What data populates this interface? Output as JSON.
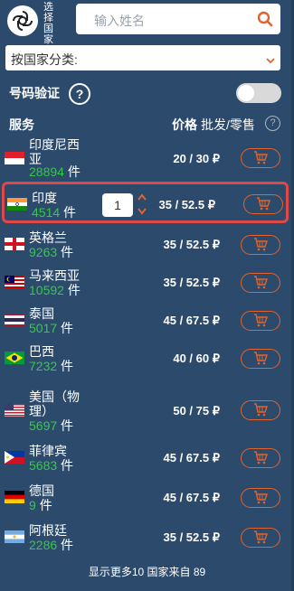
{
  "brand": {
    "text": "选择国家"
  },
  "search": {
    "placeholder": "输入姓名"
  },
  "category_select": {
    "value": "按国家分类:"
  },
  "verify": {
    "label": "号码验证",
    "help": "?",
    "enabled": false
  },
  "table_header": {
    "service": "服务",
    "price": "价格",
    "sub": "批发/零售",
    "help": "?"
  },
  "currency": "₽",
  "rows": [
    {
      "name": "印度尼西亚",
      "count": "28894",
      "unit": "件",
      "price": "20 / 30 ₽",
      "flag": "indonesia"
    },
    {
      "name": "印度",
      "count": "4514",
      "unit": "件",
      "price": "35 / 52.5 ₽",
      "flag": "india",
      "qty": "1",
      "selected": true
    },
    {
      "name": "英格兰",
      "count": "9263",
      "unit": "件",
      "price": "35 / 52.5 ₽",
      "flag": "england"
    },
    {
      "name": "马来西亚",
      "count": "10592",
      "unit": "件",
      "price": "35 / 52.5 ₽",
      "flag": "malaysia"
    },
    {
      "name": "泰国",
      "count": "5017",
      "unit": "件",
      "price": "45 / 67.5 ₽",
      "flag": "thailand"
    },
    {
      "name": "巴西",
      "count": "7232",
      "unit": "件",
      "price": "40 / 60 ₽",
      "flag": "brazil"
    },
    {
      "name": "美国（物理）",
      "count": "5697",
      "unit": "件",
      "price": "50 / 75 ₽",
      "flag": "usa"
    },
    {
      "name": "菲律宾",
      "count": "5683",
      "unit": "件",
      "price": "45 / 67.5 ₽",
      "flag": "philippines"
    },
    {
      "name": "德国",
      "count": "9",
      "unit": "件",
      "price": "45 / 67.5 ₽",
      "flag": "germany"
    },
    {
      "name": "阿根廷",
      "count": "2286",
      "unit": "件",
      "price": "35 / 52.5 ₽",
      "flag": "argentina"
    }
  ],
  "footer": {
    "text": "显示更多10 国家来自 89"
  },
  "colors": {
    "background": "#2b4a6c",
    "accent": "#e2632c",
    "count": "#37c84a",
    "highlight": "#e04848"
  }
}
